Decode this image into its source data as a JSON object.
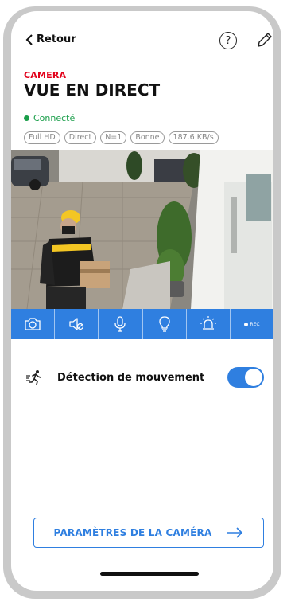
{
  "header": {
    "back_label": "Retour",
    "help_symbol": "?",
    "back_icon": "chevron-left-icon",
    "edit_icon": "pencil-icon"
  },
  "page": {
    "overline": "CAMERA",
    "title": "VUE EN DIRECT"
  },
  "status": {
    "label": "Connecté",
    "color": "#1a9e4a"
  },
  "stream_badges": [
    "Full HD",
    "Direct",
    "N=1",
    "Bonne",
    "187.6 KB/s"
  ],
  "toolbar": {
    "items": [
      {
        "icon": "camera-icon"
      },
      {
        "icon": "speaker-mute-icon"
      },
      {
        "icon": "microphone-icon"
      },
      {
        "icon": "light-bulb-icon"
      },
      {
        "icon": "siren-icon"
      },
      {
        "icon": "record-icon",
        "label": "REC"
      }
    ],
    "color": "#2f7fe0"
  },
  "motion_detection": {
    "label": "Détection de mouvement",
    "icon": "running-person-icon",
    "enabled": true
  },
  "settings_button": {
    "label": "PARAMÈTRES DE LA CAMÉRA",
    "icon": "arrow-right-icon"
  },
  "colors": {
    "accent": "#2f7fe0",
    "brand_red": "#e2001a"
  }
}
